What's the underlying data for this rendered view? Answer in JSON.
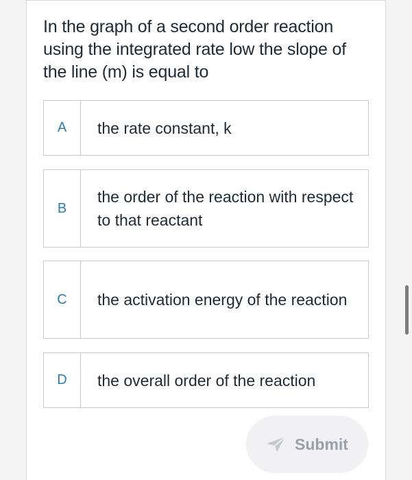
{
  "question": {
    "text": "In the graph of a second order reaction using the integrated rate low  the slope of the line (m) is equal to"
  },
  "options": [
    {
      "letter": "A",
      "text": "the rate constant, k"
    },
    {
      "letter": "B",
      "text": "the order of the reaction with respect to that reactant"
    },
    {
      "letter": "C",
      "text": "the activation energy of the reaction"
    },
    {
      "letter": "D",
      "text": "the overall order of the reaction"
    }
  ],
  "submit": {
    "label": "Submit",
    "icon": "send-icon"
  },
  "colors": {
    "letter": "#2a7bb4",
    "text": "#1f2a37",
    "border": "#c9cdd2",
    "submit_bg": "#f1f1f3",
    "submit_text": "#9aa0a7"
  }
}
